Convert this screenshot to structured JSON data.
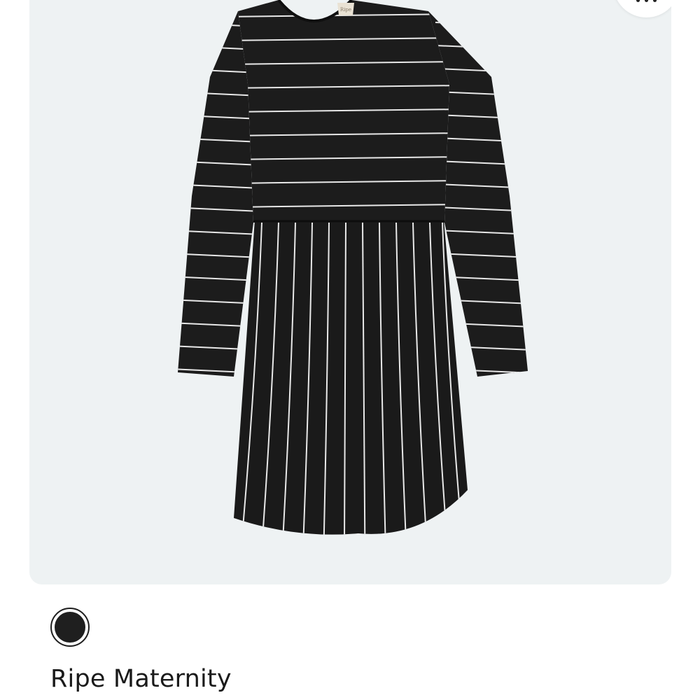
{
  "product": {
    "brand": "Ripe Maternity",
    "label_text": "Ripe",
    "image_icon": "striped-dress-image",
    "more_icon": "more-options-icon",
    "swatches": [
      {
        "name": "black",
        "color": "#1f1f1f",
        "selected": true
      }
    ]
  },
  "colors": {
    "card_background": "#eef2f3",
    "dress": "#1c1c1c",
    "stripe": "#e8e8e8"
  }
}
